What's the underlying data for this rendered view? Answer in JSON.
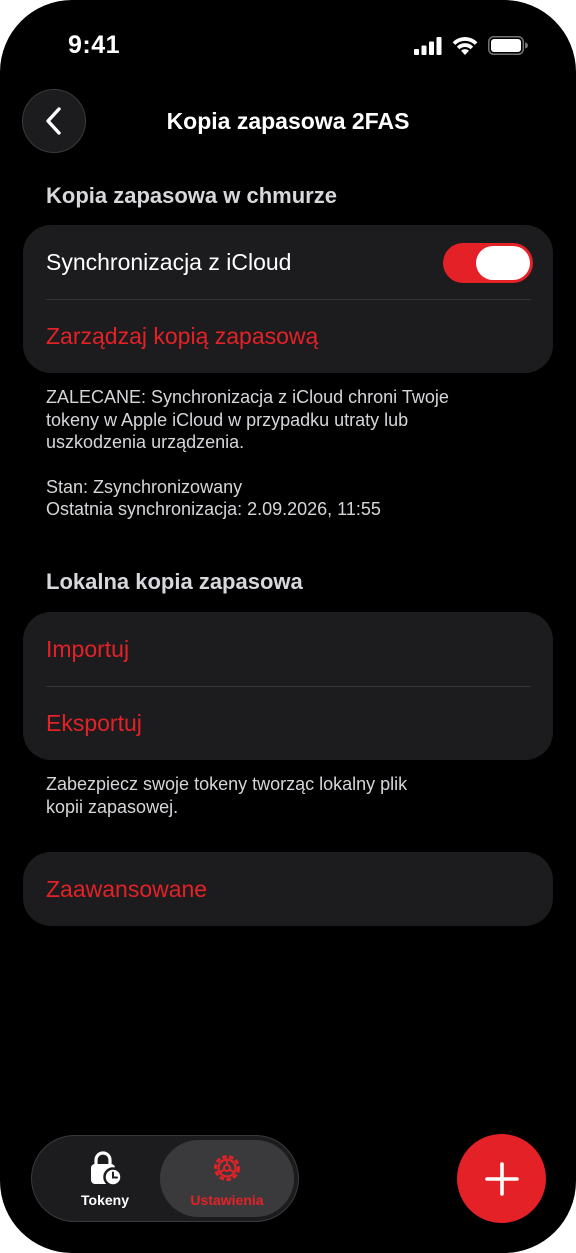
{
  "status_bar": {
    "time": "9:41"
  },
  "header": {
    "title": "Kopia zapasowa 2FAS"
  },
  "cloud_section": {
    "title": "Kopia zapasowa w chmurze",
    "sync_label": "Synchronizacja z iCloud",
    "sync_enabled": true,
    "manage_label": "Zarządzaj kopią zapasową",
    "footer": "ZALECANE: Synchronizacja z iCloud chroni Twoje\ntokeny w Apple iCloud w przypadku utraty lub\nuszkodzenia urządzenia.",
    "status_line": "Stan: Zsynchronizowany",
    "last_sync_line": "Ostatnia synchronizacja: 2.09.2026, 11:55"
  },
  "local_section": {
    "title": "Lokalna kopia zapasowa",
    "import_label": "Importuj",
    "export_label": "Eksportuj",
    "footer": "Zabezpiecz swoje tokeny tworząc lokalny plik\nkopii zapasowej."
  },
  "advanced": {
    "label": "Zaawansowane"
  },
  "tabbar": {
    "tokens_label": "Tokeny",
    "settings_label": "Ustawienia",
    "selected": "Ustawienia"
  },
  "colors": {
    "accent": "#e32127",
    "background": "#000000",
    "card": "#1c1c1e"
  },
  "icons": {
    "back": "chevron-left-icon",
    "signal": "cellular-signal-icon",
    "wifi": "wifi-icon",
    "battery": "battery-icon",
    "tokens": "lock-clock-icon",
    "settings": "gear-icon",
    "add": "plus-icon"
  }
}
